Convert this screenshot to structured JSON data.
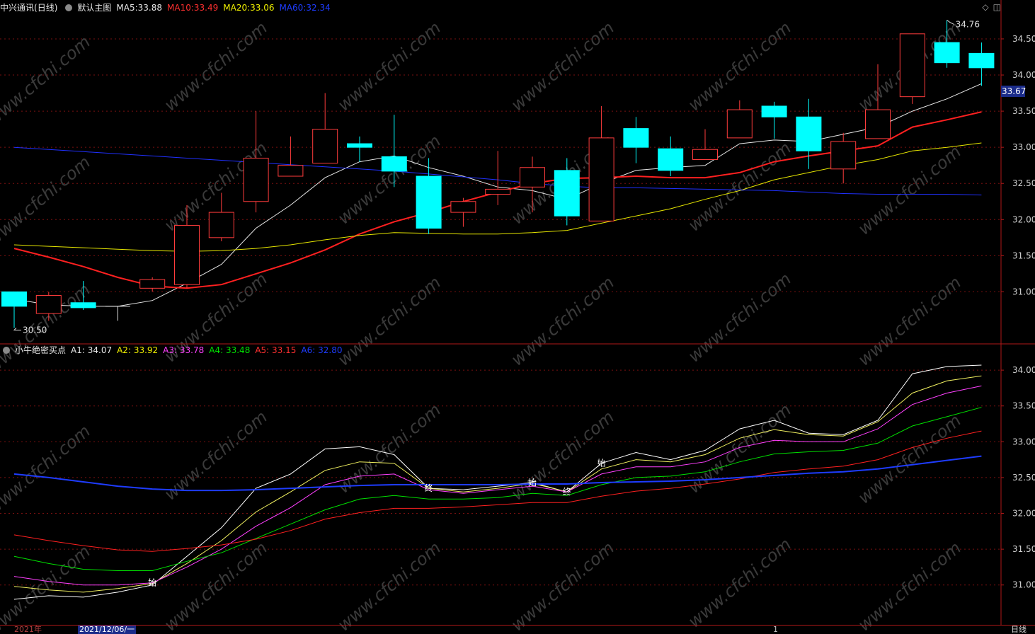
{
  "header": {
    "stock_name": "中兴通讯",
    "period_label": "(日线)",
    "view_name": "默认主图",
    "ma5_label": "MA5:",
    "ma5_value": "33.88",
    "ma10_label": "MA10:",
    "ma10_value": "33.49",
    "ma20_label": "MA20:",
    "ma20_value": "33.06",
    "ma60_label": "MA60:",
    "ma60_value": "32.34"
  },
  "indicator_header": {
    "name": "小牛绝密买点",
    "a1_label": "A1:",
    "a1_value": "34.07",
    "a2_label": "A2:",
    "a2_value": "33.92",
    "a3_label": "A3:",
    "a3_value": "33.78",
    "a4_label": "A4:",
    "a4_value": "33.48",
    "a5_label": "A5:",
    "a5_value": "33.15",
    "a6_label": "A6:",
    "a6_value": "32.80"
  },
  "last_price": "33.67",
  "high_marker": "34.76",
  "low_marker": "30.50",
  "timebar": {
    "year": "2021年",
    "cursor_date": "2021/12/06/一",
    "month_mark": "1",
    "period": "日线"
  },
  "watermark_text": "www.cfchi.com",
  "colors": {
    "background": "#000000",
    "up_candle": "#ff3c3c",
    "down_candle": "#00ffff",
    "ma5": "#e6e6e6",
    "ma10": "#ff2020",
    "ma20": "#e6e600",
    "ma60": "#2030ff",
    "a1": "#ffffff",
    "a2": "#f0f060",
    "a3": "#ff40ff",
    "a4": "#00e000",
    "a5": "#ff2020",
    "a6": "#1e3cff",
    "grid": "#7a1010",
    "axis": "#b01818"
  },
  "chart_data": [
    {
      "type": "candlestick",
      "title": "中兴通讯 (日线)",
      "yticks": [
        31.0,
        31.5,
        32.0,
        32.5,
        33.0,
        33.5,
        34.0,
        34.5
      ],
      "ylim": [
        30.45,
        34.95
      ],
      "grid": true,
      "candles": [
        {
          "open": 31.0,
          "close": 30.8,
          "high": 30.9,
          "low": 30.5
        },
        {
          "open": 30.7,
          "close": 30.95,
          "high": 31.0,
          "low": 30.6
        },
        {
          "open": 30.85,
          "close": 30.78,
          "high": 31.15,
          "low": 30.75
        },
        {
          "open": 30.8,
          "close": 30.8,
          "high": 30.8,
          "low": 30.6
        },
        {
          "open": 31.05,
          "close": 31.17,
          "high": 31.2,
          "low": 31.0
        },
        {
          "open": 31.1,
          "close": 31.92,
          "high": 32.2,
          "low": 31.05
        },
        {
          "open": 31.75,
          "close": 32.1,
          "high": 32.37,
          "low": 31.7
        },
        {
          "open": 32.25,
          "close": 32.85,
          "high": 33.5,
          "low": 32.1
        },
        {
          "open": 32.6,
          "close": 32.75,
          "high": 33.15,
          "low": 32.6
        },
        {
          "open": 32.78,
          "close": 33.25,
          "high": 33.75,
          "low": 32.78
        },
        {
          "open": 33.05,
          "close": 33.0,
          "high": 33.15,
          "low": 32.8
        },
        {
          "open": 32.87,
          "close": 32.67,
          "high": 33.45,
          "low": 32.45
        },
        {
          "open": 32.6,
          "close": 31.88,
          "high": 32.85,
          "low": 31.8
        },
        {
          "open": 32.1,
          "close": 32.25,
          "high": 32.3,
          "low": 31.9
        },
        {
          "open": 32.35,
          "close": 32.42,
          "high": 32.95,
          "low": 32.2
        },
        {
          "open": 32.45,
          "close": 32.72,
          "high": 32.87,
          "low": 32.1
        },
        {
          "open": 32.68,
          "close": 32.05,
          "high": 32.85,
          "low": 31.92
        },
        {
          "open": 31.98,
          "close": 33.13,
          "high": 33.57,
          "low": 31.98
        },
        {
          "open": 33.26,
          "close": 33.0,
          "high": 33.42,
          "low": 32.78
        },
        {
          "open": 32.98,
          "close": 32.68,
          "high": 33.15,
          "low": 32.6
        },
        {
          "open": 32.83,
          "close": 32.97,
          "high": 33.25,
          "low": 32.83
        },
        {
          "open": 33.13,
          "close": 33.52,
          "high": 33.65,
          "low": 33.13
        },
        {
          "open": 33.57,
          "close": 33.42,
          "high": 33.63,
          "low": 33.12
        },
        {
          "open": 33.42,
          "close": 32.95,
          "high": 33.67,
          "low": 32.7
        },
        {
          "open": 32.7,
          "close": 33.08,
          "high": 33.2,
          "low": 32.5
        },
        {
          "open": 33.12,
          "close": 33.52,
          "high": 34.15,
          "low": 33.12
        },
        {
          "open": 33.7,
          "close": 34.57,
          "high": 34.57,
          "low": 33.6
        },
        {
          "open": 34.45,
          "close": 34.17,
          "high": 34.76,
          "low": 34.1
        },
        {
          "open": 34.3,
          "close": 34.1,
          "high": 34.45,
          "low": 33.85
        }
      ],
      "series": [
        {
          "name": "MA5",
          "values": [
            30.9,
            30.82,
            30.8,
            30.8,
            30.88,
            31.12,
            31.38,
            31.88,
            32.2,
            32.58,
            32.8,
            32.88,
            32.72,
            32.6,
            32.45,
            32.4,
            32.28,
            32.5,
            32.68,
            32.72,
            32.75,
            33.05,
            33.1,
            33.08,
            33.18,
            33.28,
            33.5,
            33.67,
            33.88
          ]
        },
        {
          "name": "MA10",
          "values": [
            31.6,
            31.48,
            31.35,
            31.2,
            31.08,
            31.05,
            31.1,
            31.25,
            31.4,
            31.58,
            31.8,
            31.97,
            32.1,
            32.25,
            32.38,
            32.5,
            32.57,
            32.58,
            32.6,
            32.58,
            32.58,
            32.65,
            32.8,
            32.88,
            32.95,
            33.02,
            33.28,
            33.38,
            33.49
          ]
        },
        {
          "name": "MA20",
          "values": [
            31.65,
            31.63,
            31.61,
            31.59,
            31.57,
            31.56,
            31.57,
            31.6,
            31.65,
            31.72,
            31.78,
            31.82,
            31.81,
            31.8,
            31.8,
            31.82,
            31.85,
            31.95,
            32.05,
            32.15,
            32.28,
            32.4,
            32.55,
            32.65,
            32.75,
            32.83,
            32.95,
            33.0,
            33.06
          ]
        },
        {
          "name": "MA60",
          "values": [
            33.0,
            32.97,
            32.94,
            32.91,
            32.88,
            32.85,
            32.82,
            32.79,
            32.76,
            32.73,
            32.7,
            32.67,
            32.63,
            32.59,
            32.55,
            32.5,
            32.46,
            32.44,
            32.44,
            32.43,
            32.42,
            32.41,
            32.4,
            32.38,
            32.36,
            32.35,
            32.35,
            32.35,
            32.34
          ]
        }
      ]
    },
    {
      "type": "line",
      "title": "小牛绝密买点",
      "yticks": [
        31.0,
        31.5,
        32.0,
        32.5,
        33.0,
        33.5,
        34.0
      ],
      "ylim": [
        30.45,
        34.25
      ],
      "grid": true,
      "series": [
        {
          "name": "A1",
          "values": [
            30.8,
            30.85,
            30.83,
            30.9,
            31.0,
            31.4,
            31.8,
            32.35,
            32.55,
            32.9,
            32.93,
            32.82,
            32.35,
            32.33,
            32.38,
            32.43,
            32.3,
            32.7,
            32.85,
            32.75,
            32.88,
            33.18,
            33.3,
            33.12,
            33.1,
            33.3,
            33.95,
            34.05,
            34.07
          ]
        },
        {
          "name": "A2",
          "values": [
            30.98,
            30.93,
            30.9,
            30.95,
            31.02,
            31.3,
            31.62,
            32.02,
            32.3,
            32.6,
            32.72,
            32.7,
            32.35,
            32.3,
            32.35,
            32.42,
            32.3,
            32.62,
            32.75,
            32.72,
            32.82,
            33.05,
            33.17,
            33.1,
            33.08,
            33.28,
            33.68,
            33.85,
            33.92
          ]
        },
        {
          "name": "A3",
          "values": [
            31.12,
            31.05,
            31.0,
            31.0,
            31.03,
            31.25,
            31.5,
            31.82,
            32.08,
            32.4,
            32.52,
            32.55,
            32.33,
            32.28,
            32.33,
            32.38,
            32.3,
            32.55,
            32.65,
            32.65,
            32.72,
            32.92,
            33.02,
            33.0,
            33.0,
            33.18,
            33.52,
            33.68,
            33.78
          ]
        },
        {
          "name": "A4",
          "values": [
            31.4,
            31.3,
            31.22,
            31.2,
            31.2,
            31.33,
            31.45,
            31.65,
            31.85,
            32.05,
            32.2,
            32.25,
            32.2,
            32.2,
            32.22,
            32.28,
            32.25,
            32.4,
            32.5,
            32.52,
            32.58,
            32.72,
            32.83,
            32.86,
            32.88,
            32.98,
            33.22,
            33.35,
            33.48
          ]
        },
        {
          "name": "A5",
          "values": [
            31.7,
            31.62,
            31.55,
            31.49,
            31.47,
            31.51,
            31.56,
            31.64,
            31.76,
            31.92,
            32.01,
            32.07,
            32.07,
            32.09,
            32.12,
            32.15,
            32.15,
            32.24,
            32.31,
            32.35,
            32.41,
            32.48,
            32.57,
            32.62,
            32.66,
            32.75,
            32.92,
            33.05,
            33.15
          ]
        },
        {
          "name": "A6",
          "values": [
            32.55,
            32.5,
            32.44,
            32.38,
            32.34,
            32.32,
            32.32,
            32.33,
            32.35,
            32.37,
            32.39,
            32.4,
            32.4,
            32.4,
            32.4,
            32.41,
            32.41,
            32.43,
            32.44,
            32.45,
            32.47,
            32.5,
            32.53,
            32.56,
            32.58,
            32.62,
            32.68,
            32.74,
            32.8
          ]
        }
      ],
      "annotations": [
        {
          "text": "始",
          "index": 4,
          "series": "A3"
        },
        {
          "text": "终",
          "index": 12,
          "series": "A2"
        },
        {
          "text": "始",
          "index": 15,
          "series": "A1"
        },
        {
          "text": "终",
          "index": 16,
          "series": "A1"
        },
        {
          "text": "始",
          "index": 17,
          "series": "A1"
        }
      ]
    }
  ]
}
